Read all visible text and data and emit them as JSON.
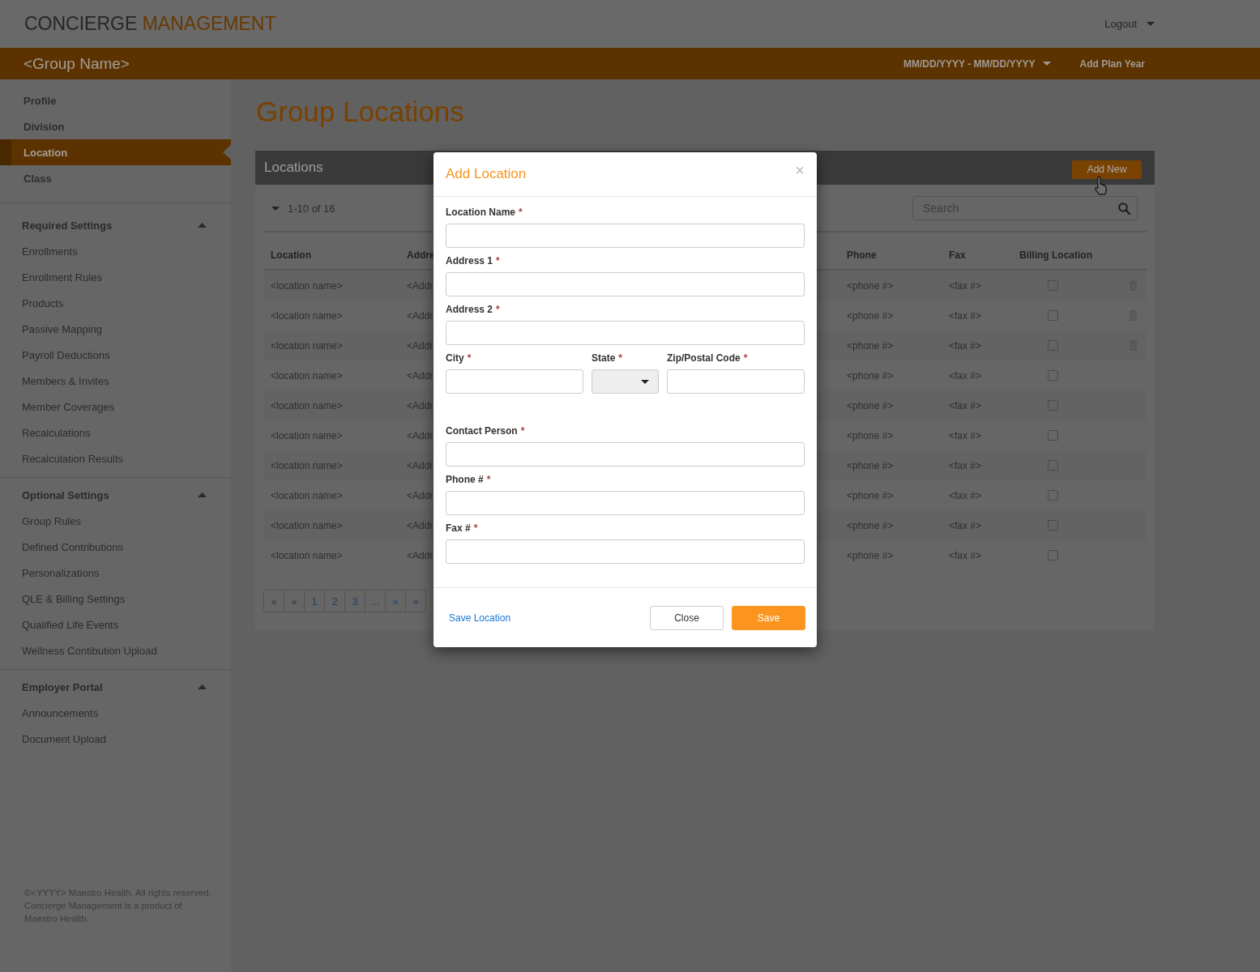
{
  "header": {
    "logo": {
      "primary": "CONCIERGE",
      "accent": "MANAGEMENT"
    },
    "user_menu": "Logout"
  },
  "group_bar": {
    "group_name": "<Group Name>",
    "plan_year": "MM/DD/YYYY - MM/DD/YYYY",
    "add_plan_year": "Add Plan Year"
  },
  "sidebar": {
    "items": [
      {
        "label": "Profile",
        "selected": false
      },
      {
        "label": "Division",
        "selected": false
      },
      {
        "label": "Location",
        "selected": true
      },
      {
        "label": "Class",
        "selected": false
      }
    ],
    "sections": [
      {
        "title": "Required Settings",
        "expanded": true,
        "items": [
          {
            "label": "Enrollments",
            "selected": false
          },
          {
            "label": "Enrollment Rules",
            "selected": false
          },
          {
            "label": "Products",
            "selected": false
          },
          {
            "label": "Passive Mapping",
            "selected": false
          },
          {
            "label": "Payroll Deductions",
            "selected": false
          },
          {
            "label": "Members & Invites",
            "selected": false
          },
          {
            "label": "Member Coverages",
            "selected": false
          },
          {
            "label": "Recalculations",
            "selected": false
          },
          {
            "label": "Recalculation Results",
            "selected": false
          }
        ]
      },
      {
        "title": "Optional Settings",
        "expanded": true,
        "items": [
          {
            "label": "Group Rules",
            "selected": false
          },
          {
            "label": "Defined Contributions",
            "selected": false
          },
          {
            "label": "Personalizations",
            "selected": false
          },
          {
            "label": "QLE & Billing Settings",
            "selected": false
          },
          {
            "label": "Qualified Life Events",
            "selected": false
          },
          {
            "label": "Wellness Contibution Upload",
            "selected": false
          }
        ]
      },
      {
        "title": "Employer Portal",
        "expanded": true,
        "items": [
          {
            "label": "Announcements",
            "selected": false
          },
          {
            "label": "Document Upload",
            "selected": false
          }
        ]
      }
    ],
    "footer": "©<YYYY> Maestro Health. All rights reserved. Concierge Management is a product of Maestro Health."
  },
  "page_title": "Group Locations",
  "panel": {
    "title": "Locations",
    "add_button": "Add New",
    "count": "1-10 of 16",
    "search": {
      "placeholder": "Search"
    },
    "table": {
      "columns": [
        "Location",
        "Addre",
        "Phone",
        "Fax",
        "Billing Location"
      ],
      "rows": [
        {
          "location": "<location name>",
          "address": "<Addr",
          "phone": "<phone #>",
          "fax": "<fax #>",
          "billing_location": false,
          "deletable": true
        },
        {
          "location": "<location name>",
          "address": "<Addr",
          "phone": "<phone #>",
          "fax": "<fax #>",
          "billing_location": false,
          "deletable": true
        },
        {
          "location": "<location name>",
          "address": "<Addr",
          "phone": "<phone #>",
          "fax": "<fax #>",
          "billing_location": false,
          "deletable": true
        },
        {
          "location": "<location name>",
          "address": "<Addr",
          "phone": "<phone #>",
          "fax": "<fax #>",
          "billing_location": false,
          "deletable": false
        },
        {
          "location": "<location name>",
          "address": "<Addr",
          "phone": "<phone #>",
          "fax": "<fax #>",
          "billing_location": false,
          "deletable": false
        },
        {
          "location": "<location name>",
          "address": "<Addr",
          "phone": "<phone #>",
          "fax": "<fax #>",
          "billing_location": false,
          "deletable": false
        },
        {
          "location": "<location name>",
          "address": "<Addr",
          "phone": "<phone #>",
          "fax": "<fax #>",
          "billing_location": false,
          "deletable": false
        },
        {
          "location": "<location name>",
          "address": "<Addr",
          "phone": "<phone #>",
          "fax": "<fax #>",
          "billing_location": false,
          "deletable": false
        },
        {
          "location": "<location name>",
          "address": "<Addr",
          "phone": "<phone #>",
          "fax": "<fax #>",
          "billing_location": false,
          "deletable": false
        },
        {
          "location": "<location name>",
          "address": "<Addr",
          "phone": "<phone #>",
          "fax": "<fax #>",
          "billing_location": false,
          "deletable": false
        }
      ]
    },
    "pagination": [
      {
        "label": "«",
        "disabled": true,
        "selected": false
      },
      {
        "label": "«",
        "disabled": true,
        "selected": false
      },
      {
        "label": "1",
        "disabled": false,
        "selected": false
      },
      {
        "label": "2",
        "disabled": false,
        "selected": false
      },
      {
        "label": "3",
        "disabled": false,
        "selected": false
      },
      {
        "label": "…",
        "disabled": false,
        "selected": false
      },
      {
        "label": "»",
        "disabled": false,
        "selected": false
      },
      {
        "label": "»",
        "disabled": false,
        "selected": false
      }
    ]
  },
  "modal": {
    "title": "Add Location",
    "close": "×",
    "fields": [
      {
        "kind": "text",
        "label": "Location Name",
        "required_mark": "*"
      },
      {
        "kind": "text",
        "label": "Address 1",
        "required_mark": "*"
      },
      {
        "kind": "text",
        "label": "Address 2",
        "required_mark": "*"
      },
      {
        "kind": "row",
        "fields": [
          {
            "kind": "text",
            "label": "City",
            "required_mark": "*"
          },
          {
            "kind": "select",
            "label": "State",
            "required_mark": "*"
          },
          {
            "kind": "text",
            "label": "Zip/Postal Code",
            "required_mark": "*"
          }
        ]
      },
      {
        "kind": "text",
        "label": "Contact Person",
        "required_mark": "*"
      },
      {
        "kind": "text",
        "label": "Phone #",
        "required_mark": "*"
      },
      {
        "kind": "text",
        "label": "Fax #",
        "required_mark": "*"
      }
    ],
    "link": "Save Location",
    "buttons": [
      {
        "kind": "secondary",
        "label": "Close"
      },
      {
        "kind": "primary",
        "label": "Save"
      }
    ]
  }
}
